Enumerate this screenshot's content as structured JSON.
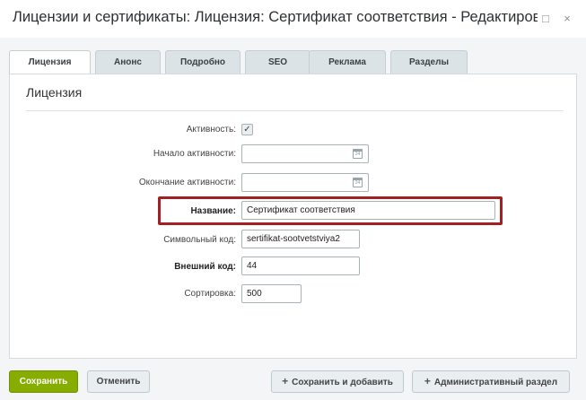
{
  "window": {
    "title": "Лицензии и сертификаты: Лицензия: Сертификат соответствия - Редактирование",
    "expand_glyph": "□",
    "close_glyph": "×"
  },
  "tabs": [
    {
      "label": "Лицензия",
      "active": true
    },
    {
      "label": "Анонс",
      "active": false
    },
    {
      "label": "Подробно",
      "active": false
    },
    {
      "label": "SEO",
      "active": false
    },
    {
      "label": "Реклама",
      "active": false
    },
    {
      "label": "Разделы",
      "active": false
    }
  ],
  "panel": {
    "heading": "Лицензия"
  },
  "form": {
    "active": {
      "label": "Активность:",
      "checked": true,
      "mark": "✓"
    },
    "start": {
      "label": "Начало активности:",
      "value": ""
    },
    "end": {
      "label": "Окончание активности:",
      "value": ""
    },
    "name": {
      "label": "Название:",
      "value": "Сертификат соответствия"
    },
    "code": {
      "label": "Символьный код:",
      "value": "sertifikat-sootvetstviya2"
    },
    "external": {
      "label": "Внешний код:",
      "value": "44"
    },
    "sort": {
      "label": "Сортировка:",
      "value": "500"
    },
    "calendar_glyph": "24"
  },
  "buttons": {
    "save": "Сохранить",
    "cancel": "Отменить",
    "save_add": "Сохранить и добавить",
    "admin_section": "Административный раздел",
    "plus_glyph": "+"
  },
  "colors": {
    "highlight": "#a31f24",
    "save_button": "#86ad00"
  }
}
